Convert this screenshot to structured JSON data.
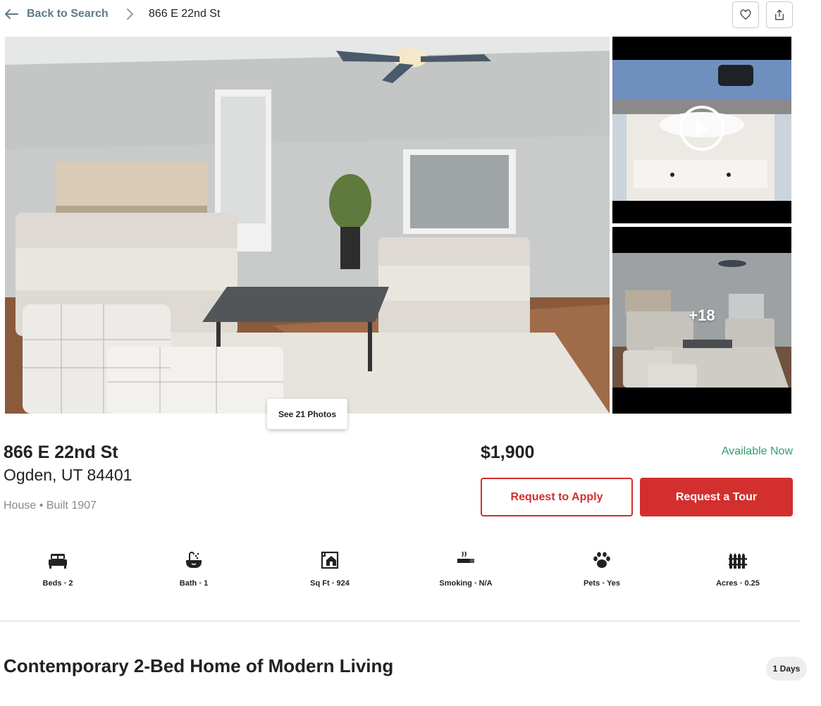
{
  "header": {
    "back_label": "Back to Search",
    "breadcrumb_current": "866 E 22nd St"
  },
  "gallery": {
    "see_photos_label": "See 21 Photos",
    "more_photos_count": "+18"
  },
  "listing": {
    "street": "866 E 22nd St",
    "city_state_zip": "Ogden, UT 84401",
    "property_type": "House",
    "built": "Built 1907",
    "price": "$1,900",
    "availability": "Available Now"
  },
  "actions": {
    "apply_label": "Request to Apply",
    "tour_label": "Request a Tour"
  },
  "facts": [
    {
      "label": "Beds",
      "value": "2",
      "icon": "bed-icon"
    },
    {
      "label": "Bath",
      "value": "1",
      "icon": "bath-icon"
    },
    {
      "label": "Sq Ft",
      "value": "924",
      "icon": "house-icon"
    },
    {
      "label": "Smoking",
      "value": "N/A",
      "icon": "smoking-icon"
    },
    {
      "label": "Pets",
      "value": "Yes",
      "icon": "paw-icon"
    },
    {
      "label": "Acres",
      "value": "0.25",
      "icon": "fence-icon"
    }
  ],
  "description": {
    "headline": "Contemporary 2-Bed Home of Modern Living",
    "days_on_market": "1 Days"
  },
  "colors": {
    "accent_red": "#d32f2f",
    "back_link": "#5c7c8a",
    "available_green": "#2f9e6e"
  }
}
